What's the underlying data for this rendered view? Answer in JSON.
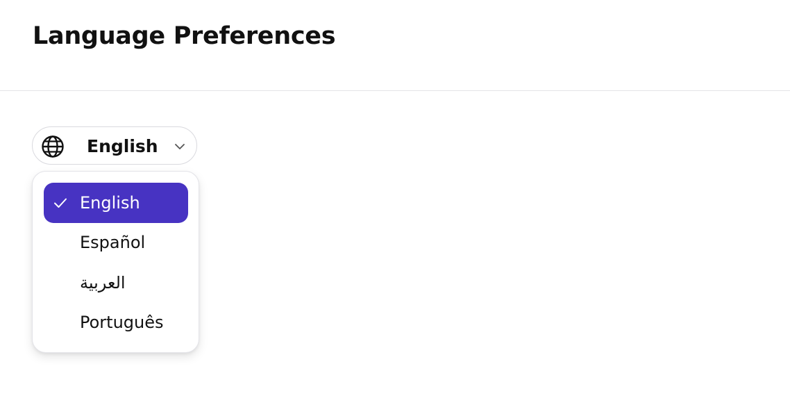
{
  "page": {
    "title": "Language Preferences"
  },
  "language_selector": {
    "current": "English",
    "icon": "globe-icon",
    "chevron_icon": "chevron-down-icon",
    "options": [
      {
        "label": "English",
        "selected": true
      },
      {
        "label": "Español",
        "selected": false
      },
      {
        "label": "العربية",
        "selected": false
      },
      {
        "label": "Português",
        "selected": false
      }
    ]
  },
  "colors": {
    "accent": "#4733c2",
    "text": "#111111",
    "divider": "#e4e4e7"
  }
}
